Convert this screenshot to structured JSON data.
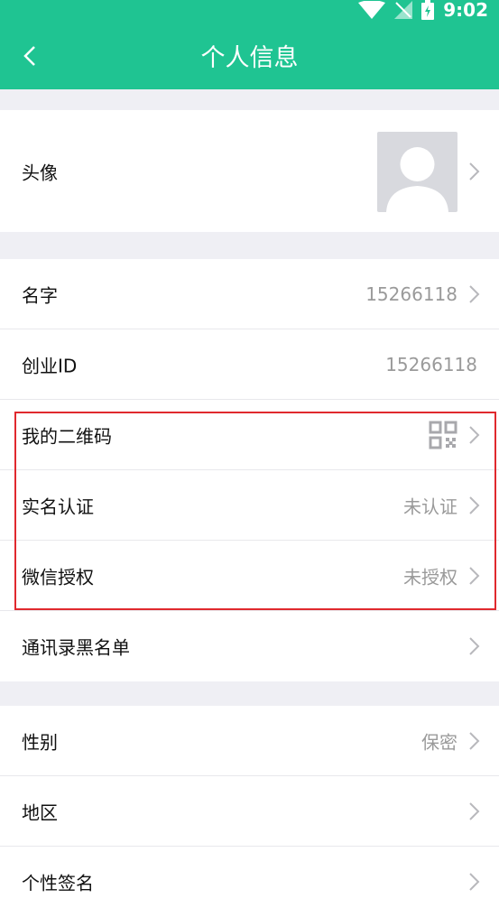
{
  "status": {
    "time": "9:02"
  },
  "header": {
    "title": "个人信息"
  },
  "avatar_row": {
    "label": "头像"
  },
  "info": [
    {
      "label": "名字",
      "value": "15266118",
      "arrow": true
    },
    {
      "label": "创业ID",
      "value": "15266118",
      "arrow": false
    },
    {
      "label": "我的二维码",
      "value": "",
      "arrow": true,
      "icon": "qr-code-icon"
    },
    {
      "label": "实名认证",
      "value": "未认证",
      "arrow": true
    },
    {
      "label": "微信授权",
      "value": "未授权",
      "arrow": true
    },
    {
      "label": "通讯录黑名单",
      "value": "",
      "arrow": true
    }
  ],
  "personal": [
    {
      "label": "性别",
      "value": "保密",
      "arrow": true
    },
    {
      "label": "地区",
      "value": "",
      "arrow": true
    },
    {
      "label": "个性签名",
      "value": "",
      "arrow": true
    }
  ],
  "colors": {
    "brand": "#1fc492",
    "highlight": "#e0292e"
  }
}
